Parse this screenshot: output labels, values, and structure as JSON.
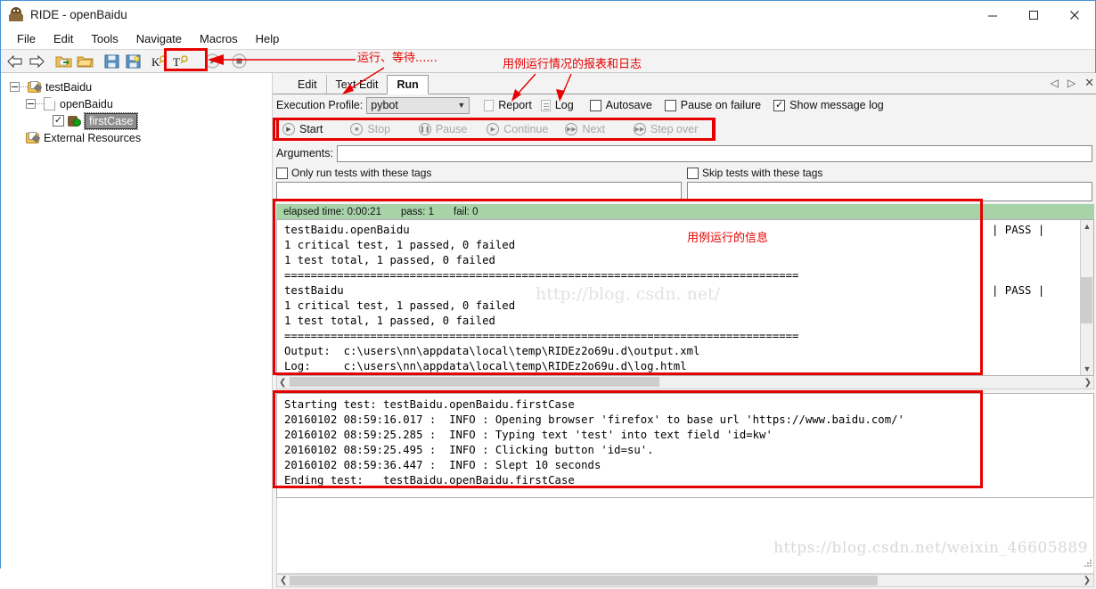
{
  "window": {
    "title": "RIDE - openBaidu",
    "icon": "robot-icon",
    "minimize": "minimize-button",
    "maximize": "maximize-button",
    "close": "close-button"
  },
  "menubar": {
    "items": [
      "File",
      "Edit",
      "Tools",
      "Navigate",
      "Macros",
      "Help"
    ]
  },
  "toolbar": {
    "items": [
      {
        "name": "back-arrow-icon",
        "glyph": "⇦"
      },
      {
        "name": "forward-arrow-icon",
        "glyph": "⇨"
      },
      {
        "name": "open-directory-icon",
        "glyph": "folder-arrow"
      },
      {
        "name": "open-file-icon",
        "glyph": "folder"
      },
      {
        "name": "save-icon",
        "glyph": "floppy"
      },
      {
        "name": "save-all-icon",
        "glyph": "floppy-star"
      },
      {
        "name": "search-keyword-icon",
        "glyph": "K"
      },
      {
        "name": "search-tests-icon",
        "glyph": "T"
      },
      {
        "name": "run-icon",
        "glyph": "▶"
      },
      {
        "name": "stop-icon",
        "glyph": "■"
      }
    ]
  },
  "tree": {
    "nodes": [
      {
        "label": "testBaidu",
        "icon": "project-folder-icon",
        "level": 0,
        "expanded": true
      },
      {
        "label": "openBaidu",
        "icon": "suite-file-icon",
        "level": 1,
        "expanded": true
      },
      {
        "label": "firstCase",
        "icon": "testcase-icon",
        "level": 2,
        "checked": true,
        "selected": true
      },
      {
        "label": "External Resources",
        "icon": "resources-folder-icon",
        "level": 0,
        "expanded": false
      }
    ]
  },
  "tabs": {
    "items": [
      {
        "label": "Edit",
        "active": false
      },
      {
        "label": "Text Edit",
        "active": false
      },
      {
        "label": "Run",
        "active": true
      }
    ],
    "nav_prev": "◁",
    "nav_next": "▷",
    "close": "✕"
  },
  "run_tab": {
    "execution_profile_label": "Execution Profile:",
    "execution_profile_value": "pybot",
    "report_label": "Report",
    "log_label": "Log",
    "checkboxes": [
      {
        "label": "Autosave",
        "checked": false
      },
      {
        "label": "Pause on failure",
        "checked": false
      },
      {
        "label": "Show message log",
        "checked": true
      }
    ],
    "controls": [
      {
        "label": "Start",
        "enabled": true,
        "icon": "play-icon"
      },
      {
        "label": "Stop",
        "enabled": false,
        "icon": "stop-icon"
      },
      {
        "label": "Pause",
        "enabled": false,
        "icon": "pause-icon"
      },
      {
        "label": "Continue",
        "enabled": false,
        "icon": "play-icon"
      },
      {
        "label": "Next",
        "enabled": false,
        "icon": "next-icon"
      },
      {
        "label": "Step over",
        "enabled": false,
        "icon": "step-over-icon"
      }
    ],
    "arguments_label": "Arguments:",
    "arguments_value": "",
    "include_tags_label": "Only run tests with these tags",
    "include_tags_checked": false,
    "include_tags_value": "",
    "exclude_tags_label": "Skip tests with these tags",
    "exclude_tags_checked": false,
    "exclude_tags_value": ""
  },
  "status": {
    "elapsed": "elapsed time: 0:00:21",
    "pass": "pass: 1",
    "fail": "fail: 0"
  },
  "output_console": {
    "lines": "testBaidu.openBaidu\n1 critical test, 1 passed, 0 failed\n1 test total, 1 passed, 0 failed\n==============================================================================\ntestBaidu\n1 critical test, 1 passed, 0 failed\n1 test total, 1 passed, 0 failed\n==============================================================================\nOutput:  c:\\users\\nn\\appdata\\local\\temp\\RIDEz2o69u.d\\output.xml\nLog:     c:\\users\\nn\\appdata\\local\\temp\\RIDEz2o69u.d\\log.html",
    "pass_markers": "| PASS |\n\n\n\n| PASS |"
  },
  "message_log": {
    "lines": "Starting test: testBaidu.openBaidu.firstCase\n20160102 08:59:16.017 :  INFO : Opening browser 'firefox' to base url 'https://www.baidu.com/'\n20160102 08:59:25.285 :  INFO : Typing text 'test' into text field 'id=kw'\n20160102 08:59:25.495 :  INFO : Clicking button 'id=su'.\n20160102 08:59:36.447 :  INFO : Slept 10 seconds\nEnding test:   testBaidu.openBaidu.firstCase"
  },
  "annotations": {
    "run_wait": "运行、等待......",
    "report_log": "用例运行情况的报表和日志",
    "run_info": "用例运行的信息",
    "color": "#e60000"
  },
  "watermark": {
    "bottom": "https://blog.csdn.net/weixin_46605889",
    "center": "http://blog. csdn. net/"
  }
}
